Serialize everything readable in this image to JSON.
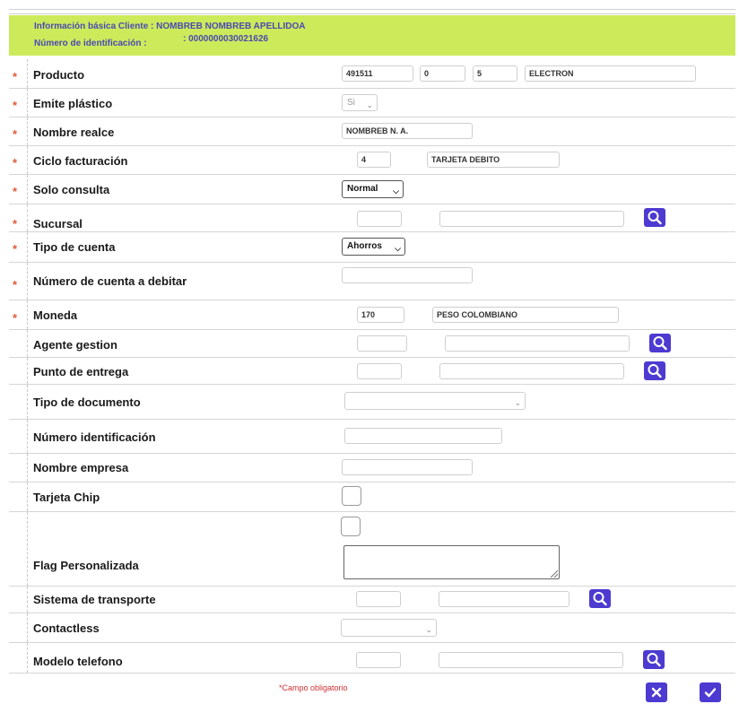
{
  "header": {
    "client_label": "Información básica Cliente :",
    "client_name": "NOMBREB NOMBREB APELLIDOA",
    "id_label": "Número de identificación :",
    "id_value": ": 0000000030021626"
  },
  "form": {
    "producto": {
      "label": "Producto",
      "code": "491511",
      "v2": "0",
      "v3": "5",
      "name": "ELECTRON",
      "required": true
    },
    "emite_plastico": {
      "label": "Emite plástico",
      "value": "Si",
      "required": true
    },
    "nombre_realce": {
      "label": "Nombre realce",
      "value": "NOMBREB N. A.",
      "required": true
    },
    "ciclo_facturacion": {
      "label": "Ciclo facturación",
      "code": "4",
      "desc": "TARJETA DEBITO",
      "required": true
    },
    "solo_consulta": {
      "label": "Solo consulta",
      "value": "Normal",
      "required": true
    },
    "sucursal": {
      "label": "Sucursal",
      "code": "",
      "desc": "",
      "required": true
    },
    "tipo_cuenta": {
      "label": "Tipo de cuenta",
      "value": "Ahorros",
      "required": true
    },
    "numero_cuenta": {
      "label": "Número de cuenta a debitar",
      "value": "",
      "required": true
    },
    "moneda": {
      "label": "Moneda",
      "code": "170",
      "desc": "PESO COLOMBIANO",
      "required": true
    },
    "agente_gestion": {
      "label": "Agente gestion",
      "code": "",
      "desc": ""
    },
    "punto_entrega": {
      "label": "Punto de entrega",
      "code": "",
      "desc": ""
    },
    "tipo_documento": {
      "label": "Tipo de documento",
      "value": ""
    },
    "numero_identificacion": {
      "label": "Número identificación",
      "value": ""
    },
    "nombre_empresa": {
      "label": "Nombre empresa",
      "value": ""
    },
    "tarjeta_chip": {
      "label": "Tarjeta Chip",
      "checked": false
    },
    "flag_personalizada": {
      "label": "Flag Personalizada",
      "checked": false,
      "value": ""
    },
    "sistema_transporte": {
      "label": "Sistema de transporte",
      "code": "",
      "desc": ""
    },
    "contactless": {
      "label": "Contactless",
      "value": ""
    },
    "modelo_telefono": {
      "label": "Modelo telefono",
      "code": "",
      "desc": ""
    }
  },
  "required_marker": "*",
  "footer": {
    "required_note": "*Campo obligatorio"
  },
  "colors": {
    "accent": "#4d3ad1",
    "header_bg": "#cdea5b",
    "required": "#e05a3a"
  },
  "icons": {
    "search": "search-icon",
    "cancel": "close-icon",
    "confirm": "check-icon"
  }
}
